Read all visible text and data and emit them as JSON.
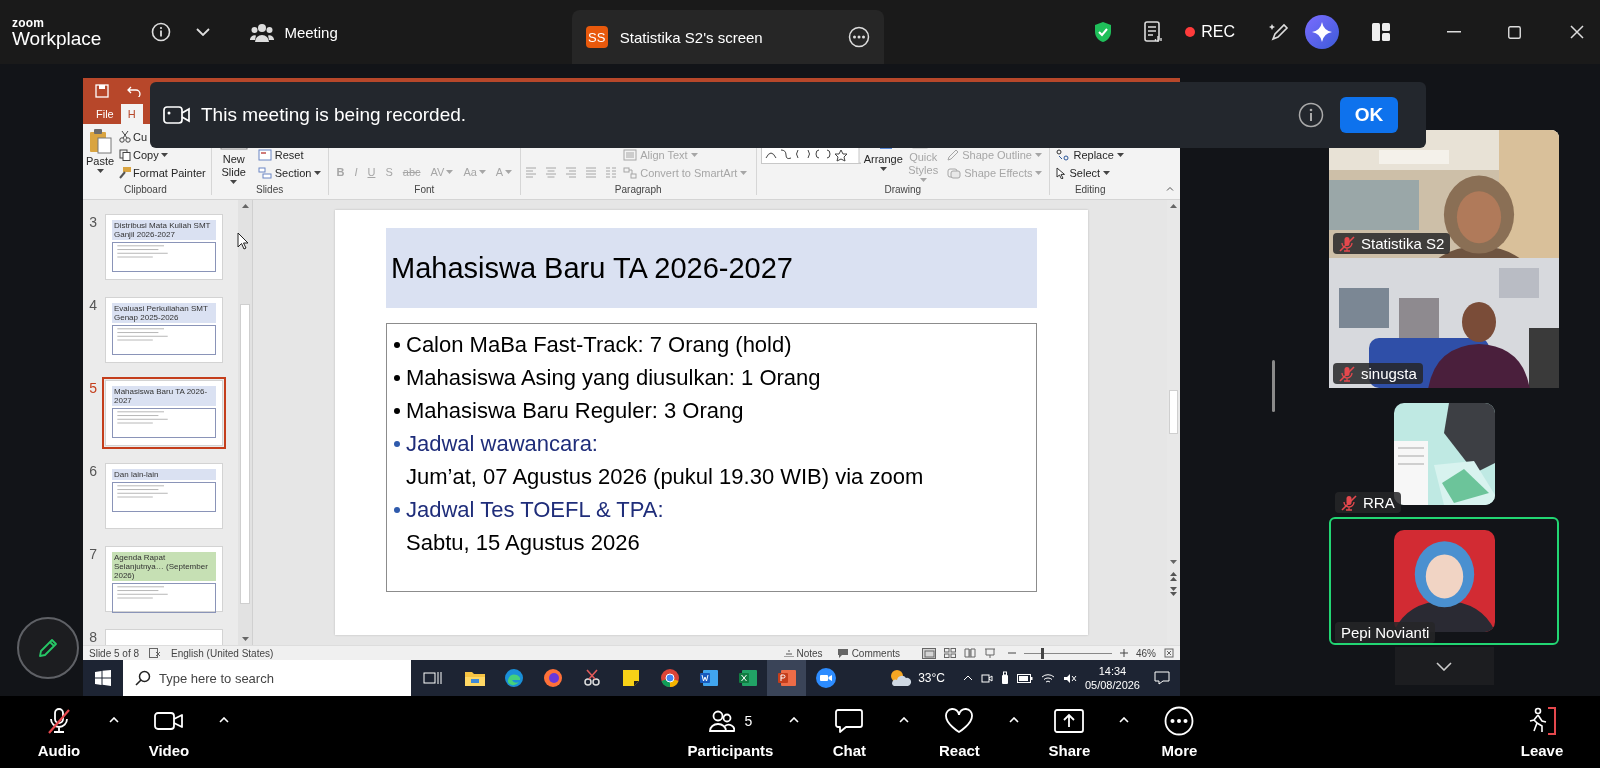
{
  "top_bar": {
    "logo": {
      "line_1": "zoom",
      "line_2": "Workplace"
    },
    "meeting_menu": "Meeting",
    "shared_screen_tab": {
      "initials": "SS",
      "title": "Statistika S2's screen"
    },
    "recording": {
      "label": "REC"
    }
  },
  "recording_banner": {
    "message": "This meeting is being recorded.",
    "button": "OK"
  },
  "presentation": {
    "tabs": [
      {
        "label": "File",
        "selected": false
      },
      {
        "label": "H",
        "selected": true
      }
    ],
    "ribbon": [
      {
        "label": "Clipboard",
        "items": [
          {
            "kind": "paste",
            "label": "Paste",
            "dropdown": true,
            "disabled": false
          },
          {
            "kind": "cut",
            "label": "Cu",
            "dropdown": false,
            "disabled": false
          },
          {
            "kind": "copy",
            "label": "Copy",
            "dropdown": true,
            "disabled": false
          },
          {
            "kind": "format-painter",
            "label": "Format Painter",
            "dropdown": false,
            "disabled": false
          }
        ]
      },
      {
        "label": "Slides",
        "items": [
          {
            "kind": "new-slide",
            "label": "New Slide",
            "dropdown": true,
            "disabled": false
          },
          {
            "kind": "reset",
            "label": "Reset",
            "dropdown": false,
            "disabled": false
          },
          {
            "kind": "section",
            "label": "Section",
            "dropdown": true,
            "disabled": false
          }
        ]
      },
      {
        "label": "Font",
        "items": [
          {
            "kind": "glyph",
            "label": "B",
            "dropdown": false,
            "disabled": true
          },
          {
            "kind": "glyph",
            "label": "I",
            "dropdown": false,
            "disabled": true
          },
          {
            "kind": "glyph",
            "label": "U",
            "dropdown": false,
            "disabled": true
          },
          {
            "kind": "glyph",
            "label": "S",
            "dropdown": false,
            "disabled": true
          },
          {
            "kind": "glyph",
            "label": "abc",
            "dropdown": false,
            "disabled": true
          },
          {
            "kind": "glyph",
            "label": "AV",
            "dropdown": true,
            "disabled": true
          },
          {
            "kind": "glyph",
            "label": "Aa",
            "dropdown": true,
            "disabled": true
          },
          {
            "kind": "glyph",
            "label": "A",
            "dropdown": true,
            "disabled": true
          }
        ]
      },
      {
        "label": "Paragraph",
        "items": [
          {
            "kind": "align-text",
            "label": "Align Text",
            "dropdown": true,
            "disabled": true
          },
          {
            "kind": "smartart",
            "label": "Convert to SmartArt",
            "dropdown": true,
            "disabled": true
          }
        ]
      },
      {
        "label": "Drawing",
        "items": [
          {
            "kind": "arrange",
            "label": "Arrange",
            "dropdown": true,
            "disabled": false
          },
          {
            "kind": "quick-styles",
            "label": "Quick Styles",
            "dropdown": true,
            "disabled": true
          },
          {
            "kind": "shape-outline",
            "label": "Shape Outline",
            "dropdown": true,
            "disabled": true
          },
          {
            "kind": "shape-effects",
            "label": "Shape Effects",
            "dropdown": true,
            "disabled": true
          }
        ]
      },
      {
        "label": "Editing",
        "items": [
          {
            "kind": "replace",
            "label": "Replace",
            "dropdown": true,
            "disabled": false
          },
          {
            "kind": "select",
            "label": "Select",
            "dropdown": true,
            "disabled": false
          }
        ]
      }
    ],
    "thumbnails": [
      {
        "number": "3",
        "title": "Distribusi Mata Kuliah SMT Ganjil 2026-2027",
        "color": "#dae1f2",
        "selected": false
      },
      {
        "number": "4",
        "title": "Evaluasi Perkuliahan SMT Genap 2025-2026",
        "color": "#dae1f2",
        "selected": false
      },
      {
        "number": "5",
        "title": "Mahasiswa Baru TA 2026-2027",
        "color": "#dae1f2",
        "selected": true
      },
      {
        "number": "6",
        "title": "Dan lain-lain",
        "color": "#dae1f2",
        "selected": false
      },
      {
        "number": "7",
        "title": "Agenda Rapat Selanjutnya… (September 2026)",
        "color": "#c6e0b4",
        "selected": false
      },
      {
        "number": "8",
        "selected": false
      }
    ],
    "slide": {
      "title": "Mahasiswa Baru TA 2026-2027",
      "bullets": [
        {
          "kind": "bullet",
          "text": "Calon MaBa Fast-Track: 7 Orang (hold)"
        },
        {
          "kind": "bullet",
          "text": "Mahasiswa Asing yang diusulkan: 1 Orang"
        },
        {
          "kind": "bullet",
          "text": "Mahasiswa Baru Reguler: 3 Orang"
        },
        {
          "kind": "heading",
          "text": "Jadwal wawancara:"
        },
        {
          "kind": "detail",
          "text": "Jum’at, 07 Agustus 2026 (pukul 19.30 WIB) via zoom"
        },
        {
          "kind": "heading",
          "text": "Jadwal Tes TOEFL & TPA:"
        },
        {
          "kind": "detail",
          "text": "Sabtu, 15 Agustus 2026"
        }
      ]
    },
    "status_bar": {
      "slide_position": "Slide 5 of 8",
      "language": "English (United States)",
      "notes": "Notes",
      "comments": "Comments",
      "zoom_slider": {
        "level": 0.2
      },
      "zoom_percent": "46%"
    },
    "taskbar": {
      "search_placeholder": "Type here to search",
      "apps": [
        {
          "kind": "file-explorer",
          "active": false
        },
        {
          "kind": "edge",
          "active": false
        },
        {
          "kind": "firefox",
          "active": false
        },
        {
          "kind": "snipping",
          "active": false
        },
        {
          "kind": "sticky-notes",
          "active": false
        },
        {
          "kind": "chrome",
          "active": false
        },
        {
          "kind": "word",
          "active": false
        },
        {
          "kind": "excel",
          "active": false
        },
        {
          "kind": "powerpoint",
          "active": true
        },
        {
          "kind": "zoom",
          "active": false
        }
      ],
      "weather": "33°C",
      "time": "14:34",
      "date": "05/08/2026"
    }
  },
  "participants": [
    {
      "name": "Statistika S2",
      "kind": "video",
      "muted": true,
      "speaking": false
    },
    {
      "name": "sinugsta",
      "kind": "video",
      "muted": true,
      "speaking": false
    },
    {
      "name": "RRA",
      "kind": "avatar",
      "muted": true,
      "speaking": false
    },
    {
      "name": "Pepi Novianti",
      "kind": "avatar",
      "muted": false,
      "speaking": true
    }
  ],
  "toolbar": [
    {
      "kind": "audio",
      "label": "Audio",
      "muted": true,
      "menu": true
    },
    {
      "kind": "video",
      "label": "Video",
      "menu": true
    },
    {
      "kind": "participants",
      "label": "Participants",
      "count": "5",
      "menu": true
    },
    {
      "kind": "chat",
      "label": "Chat",
      "menu": true
    },
    {
      "kind": "react",
      "label": "React",
      "menu": true
    },
    {
      "kind": "share",
      "label": "Share",
      "menu": true
    },
    {
      "kind": "more",
      "label": "More",
      "menu": false
    },
    {
      "kind": "leave",
      "label": "Leave",
      "menu": false
    }
  ]
}
